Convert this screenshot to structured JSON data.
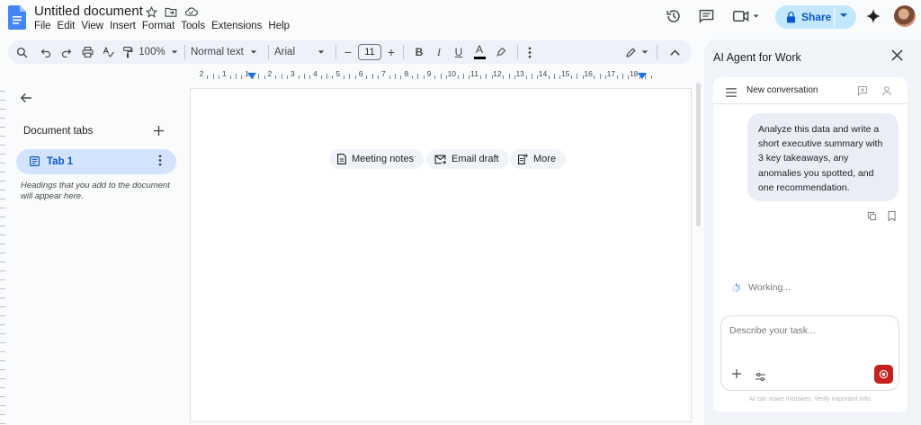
{
  "header": {
    "doc_title": "Untitled document",
    "menu": [
      "File",
      "Edit",
      "View",
      "Insert",
      "Format",
      "Tools",
      "Extensions",
      "Help"
    ],
    "share_label": "Share"
  },
  "toolbar": {
    "zoom": "100%",
    "style": "Normal text",
    "font": "Arial",
    "font_size": "11",
    "minus": "−",
    "plus": "+",
    "bold": "B",
    "italic": "I",
    "underline": "U",
    "text_color": "A"
  },
  "ruler": {
    "labels": [
      "2",
      "1",
      "1",
      "2",
      "3",
      "4",
      "5",
      "6",
      "7",
      "8",
      "9",
      "10",
      "11",
      "12",
      "13",
      "14",
      "15",
      "16",
      "17",
      "18"
    ]
  },
  "left_panel": {
    "tabs_title": "Document tabs",
    "tab_label": "Tab 1",
    "hint": "Headings that you add to the document will appear here."
  },
  "page": {
    "chips": [
      {
        "label": "Meeting notes",
        "icon": "document-icon"
      },
      {
        "label": "Email draft",
        "icon": "email-draft-icon"
      },
      {
        "label": "More",
        "icon": "more-doc-icon"
      }
    ]
  },
  "ai_panel": {
    "title": "AI Agent for Work",
    "conversation_label": "New conversation",
    "user_message": "Analyze this data and write a short executive summary with 3 key takeaways, any anomalies you spotted, and one recommendation.",
    "status": "Working...",
    "input_placeholder": "Describe your task...",
    "disclaimer": "AI can make mistakes. Verify important info."
  },
  "colors": {
    "accent_blue": "#0b57d0",
    "share_bg": "#c2e7ff",
    "tab_active_bg": "#d3e3fd",
    "send_red": "#c5221f",
    "toolbar_bg": "#edf2fa"
  }
}
